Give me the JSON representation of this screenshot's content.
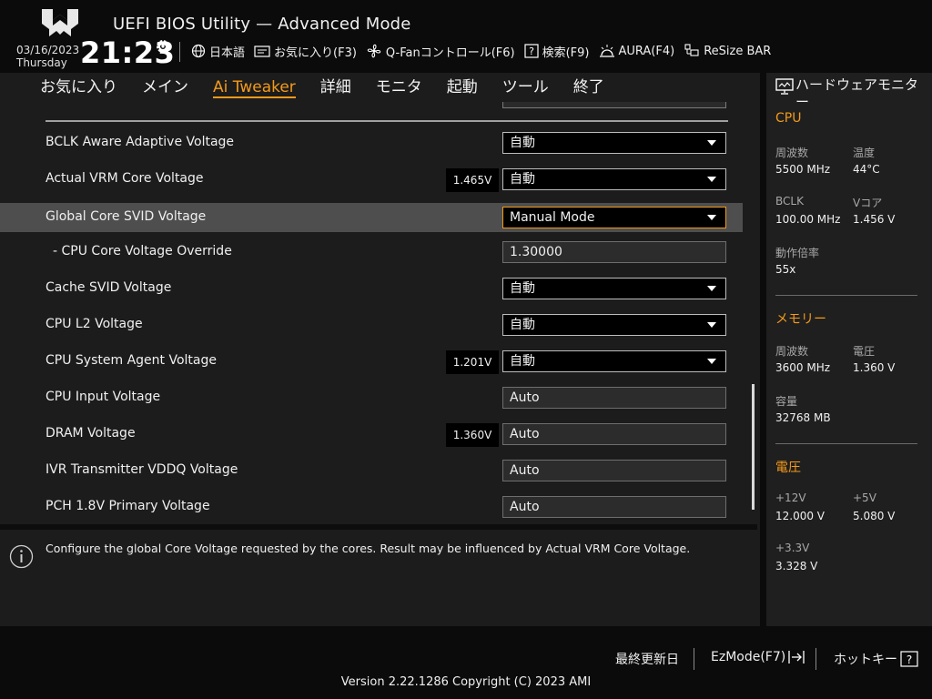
{
  "header": {
    "title": "UEFI BIOS Utility — Advanced Mode",
    "date": "03/16/2023",
    "day": "Thursday",
    "time": "21:23",
    "toolbar": [
      {
        "label": "日本語",
        "icon": "globe-icon"
      },
      {
        "label": "お気に入り(F3)",
        "icon": "favorites-icon"
      },
      {
        "label": "Q-Fanコントロール(F6)",
        "icon": "fan-icon"
      },
      {
        "label": "検索(F9)",
        "icon": "search-help-icon"
      },
      {
        "label": "AURA(F4)",
        "icon": "aura-icon"
      },
      {
        "label": "ReSize BAR",
        "icon": "resize-bar-icon"
      }
    ]
  },
  "menu": {
    "tabs": [
      "お気に入り",
      "メイン",
      "Ai Tweaker",
      "詳細",
      "モニタ",
      "起動",
      "ツール",
      "終了"
    ],
    "active": "Ai Tweaker"
  },
  "settings": [
    {
      "label": "BCLK Aware Adaptive Voltage",
      "reading": "",
      "value": "自動",
      "type": "dropdown"
    },
    {
      "label": "Actual VRM Core Voltage",
      "reading": "1.465V",
      "value": "自動",
      "type": "dropdown"
    },
    {
      "label": "Global Core SVID Voltage",
      "reading": "",
      "value": "Manual Mode",
      "type": "dropdown",
      "selected": true
    },
    {
      "label": "- CPU Core Voltage Override",
      "reading": "",
      "value": "1.30000",
      "type": "text"
    },
    {
      "label": "Cache SVID Voltage",
      "reading": "",
      "value": "自動",
      "type": "dropdown"
    },
    {
      "label": "CPU L2 Voltage",
      "reading": "",
      "value": "自動",
      "type": "dropdown"
    },
    {
      "label": "CPU System Agent Voltage",
      "reading": "1.201V",
      "value": "自動",
      "type": "dropdown"
    },
    {
      "label": "CPU Input Voltage",
      "reading": "",
      "value": "Auto",
      "type": "text"
    },
    {
      "label": "DRAM Voltage",
      "reading": "1.360V",
      "value": "Auto",
      "type": "text"
    },
    {
      "label": "IVR Transmitter VDDQ Voltage",
      "reading": "",
      "value": "Auto",
      "type": "text"
    },
    {
      "label": "PCH 1.8V Primary Voltage",
      "reading": "",
      "value": "Auto",
      "type": "text"
    }
  ],
  "help": {
    "text": "Configure the global Core Voltage requested by the cores. Result may be influenced by Actual VRM Core Voltage."
  },
  "hardware_monitor": {
    "title": "ハードウェアモニター",
    "cpu": {
      "heading": "CPU",
      "freq_label": "周波数",
      "freq": "5500 MHz",
      "temp_label": "温度",
      "temp": "44°C",
      "bclk_label": "BCLK",
      "bclk": "100.00 MHz",
      "vcore_label": "Vコア",
      "vcore": "1.456 V",
      "ratio_label": "動作倍率",
      "ratio": "55x"
    },
    "memory": {
      "heading": "メモリー",
      "freq_label": "周波数",
      "freq": "3600 MHz",
      "volt_label": "電圧",
      "volt": "1.360 V",
      "cap_label": "容量",
      "cap": "32768 MB"
    },
    "voltage": {
      "heading": "電圧",
      "v12_label": "+12V",
      "v12": "12.000 V",
      "v5_label": "+5V",
      "v5": "5.080 V",
      "v33_label": "+3.3V",
      "v33": "3.328 V"
    }
  },
  "footer": {
    "last_modified": "最終更新日",
    "ezmode": "EzMode(F7)",
    "hotkeys": "ホットキー",
    "version": "Version 2.22.1286 Copyright (C) 2023 AMI"
  },
  "colors": {
    "accent": "#f39a1b",
    "panel": "#1c1c1c",
    "background": "#0b0b0b"
  }
}
